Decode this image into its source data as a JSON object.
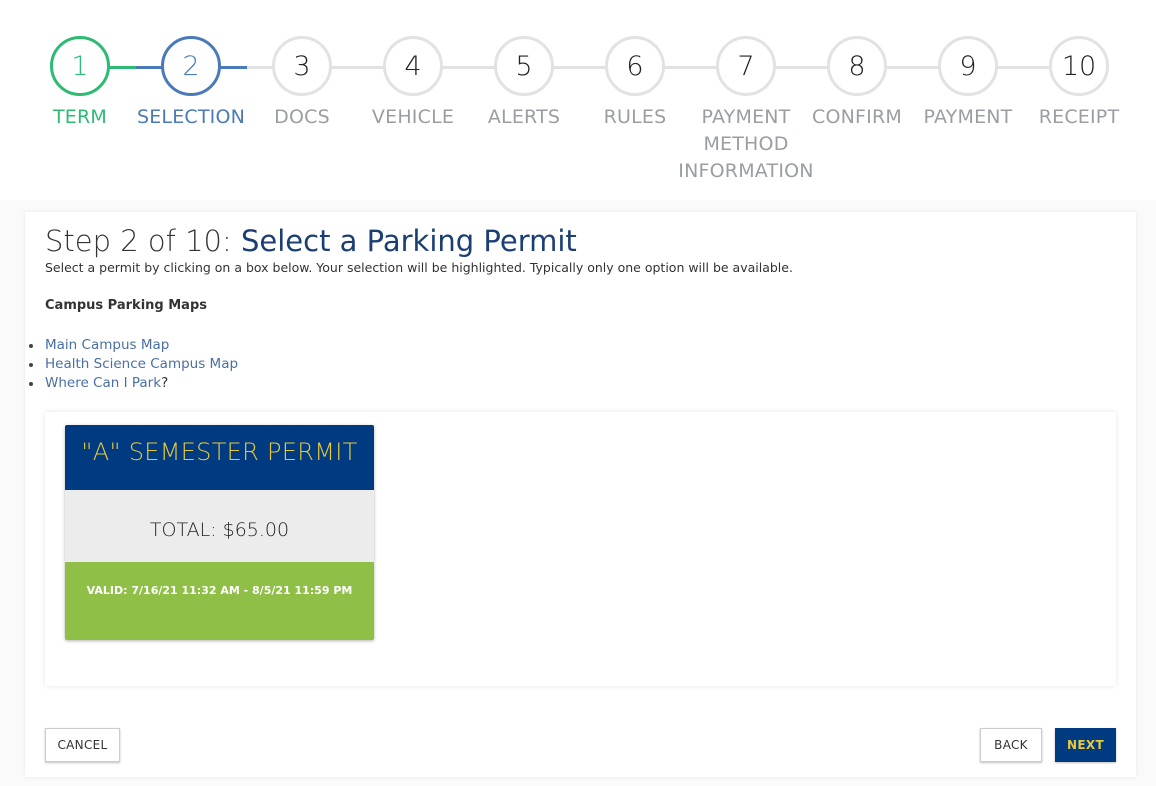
{
  "stepper": {
    "steps": [
      {
        "number": "1",
        "label": "TERM",
        "state": "done"
      },
      {
        "number": "2",
        "label": "SELECTION",
        "state": "active"
      },
      {
        "number": "3",
        "label": "DOCS",
        "state": "pending"
      },
      {
        "number": "4",
        "label": "VEHICLE",
        "state": "pending"
      },
      {
        "number": "5",
        "label": "ALERTS",
        "state": "pending"
      },
      {
        "number": "6",
        "label": "RULES",
        "state": "pending"
      },
      {
        "number": "7",
        "label": "PAYMENT METHOD INFORMATION",
        "state": "pending"
      },
      {
        "number": "8",
        "label": "CONFIRM",
        "state": "pending"
      },
      {
        "number": "9",
        "label": "PAYMENT",
        "state": "pending"
      },
      {
        "number": "10",
        "label": "RECEIPT",
        "state": "pending"
      }
    ],
    "colors": {
      "done": "#2dbb73",
      "active": "#4a7ab8",
      "pending": "#e2e2e2"
    }
  },
  "page": {
    "title_prefix": "Step 2 of 10: ",
    "title_main": "Select a Parking Permit",
    "subtitle": "Select a permit by clicking on a box below. Your selection will be highlighted. Typically only one option will be available.",
    "maps_heading": "Campus Parking Maps",
    "map_links": [
      {
        "label": "Main Campus Map"
      },
      {
        "label": "Health Science Campus Map"
      },
      {
        "label": "Where Can I Park",
        "suffix": "?"
      }
    ]
  },
  "permits": [
    {
      "name": "\"A\" SEMESTER PERMIT",
      "total": "TOTAL: $65.00",
      "valid": "VALID: 7/16/21 11:32 AM - 8/5/21 11:59 PM"
    }
  ],
  "actions": {
    "cancel": "CANCEL",
    "back": "BACK",
    "next": "NEXT"
  }
}
